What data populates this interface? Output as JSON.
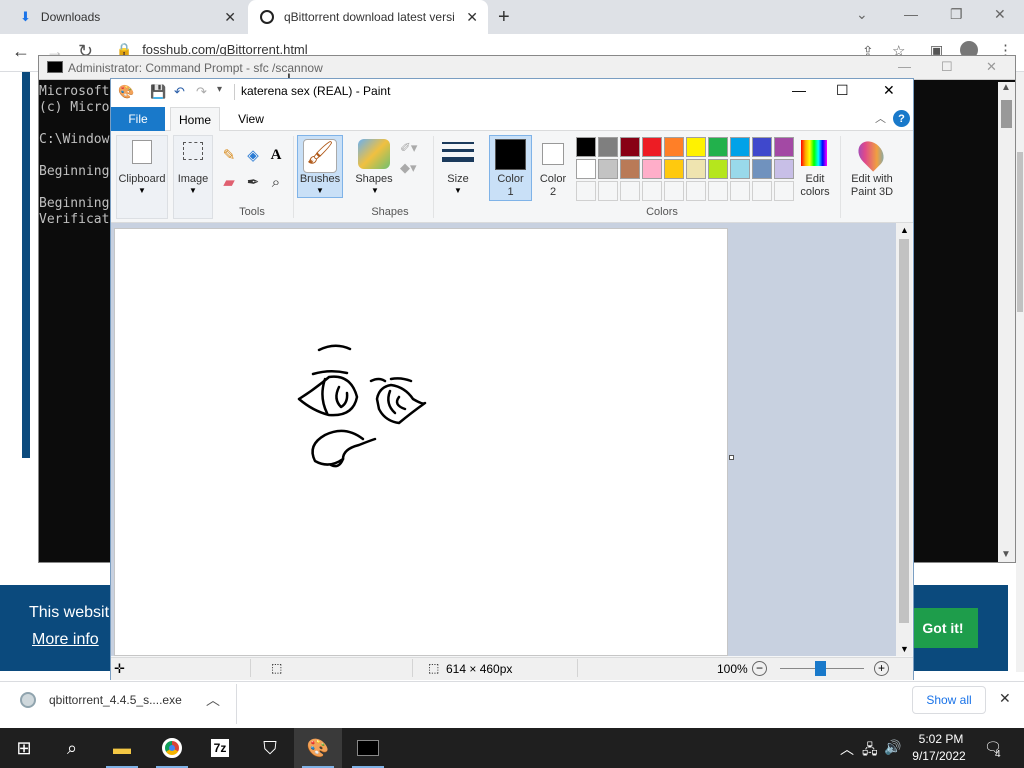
{
  "chrome": {
    "tabs": [
      {
        "label": "Downloads"
      },
      {
        "label": "qBittorrent download latest versi"
      }
    ],
    "url": "fosshub.com/qBittorrent.html"
  },
  "website": {
    "cookie_text": "This websit",
    "more_info": "More info",
    "got_it": "Got it!"
  },
  "download_bar": {
    "filename": "qbittorrent_4.4.5_s....exe",
    "show_all": "Show all"
  },
  "cmd": {
    "title": "Administrator: Command Prompt - sfc  /scannow",
    "lines": [
      "Microsoft",
      "(c) Micro",
      "",
      "C:\\Window",
      "",
      "Beginning",
      "",
      "Beginning",
      "Verificat"
    ]
  },
  "paint": {
    "title": "katerena sex (REAL) - Paint",
    "tabs": {
      "file": "File",
      "home": "Home",
      "view": "View"
    },
    "groups": {
      "clipboard": "Clipboard",
      "image": "Image",
      "tools": "Tools",
      "brushes": "Brushes",
      "shapes_btn": "Shapes",
      "shapes": "Shapes",
      "size": "Size",
      "color1": "Color\n1",
      "color2": "Color\n2",
      "colors": "Colors",
      "edit_colors": "Edit\ncolors",
      "edit_paint3d": "Edit with\nPaint 3D"
    },
    "palette_row1": [
      "#000000",
      "#7f7f7f",
      "#880015",
      "#ed1c24",
      "#ff7f27",
      "#fff200",
      "#22b14c",
      "#00a2e8",
      "#3f48cc",
      "#a349a4"
    ],
    "palette_row2": [
      "#ffffff",
      "#c3c3c3",
      "#b97a57",
      "#ffaec9",
      "#ffc90e",
      "#efe4b0",
      "#b5e61d",
      "#99d9ea",
      "#7092be",
      "#c8bfe7"
    ],
    "color1": "#000000",
    "color2": "#ffffff",
    "status": {
      "dimensions": "614 × 460px",
      "zoom": "100%"
    }
  },
  "taskbar": {
    "time": "5:02 PM",
    "date": "9/17/2022",
    "notifications": "4"
  }
}
